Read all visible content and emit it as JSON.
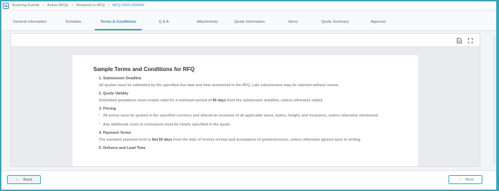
{
  "breadcrumb": {
    "items": [
      "Sourcing Events",
      "Active RFQs",
      "Respond to RFQ",
      "RFQ-2025-000040"
    ],
    "separator": ">"
  },
  "tabs": [
    {
      "label": "General Information"
    },
    {
      "label": "Schedule"
    },
    {
      "label": "Terms & Conditions",
      "active": true
    },
    {
      "label": "Q & A"
    },
    {
      "label": "Attachments"
    },
    {
      "label": "Quote Information"
    },
    {
      "label": "Items"
    },
    {
      "label": "Quote Summary"
    },
    {
      "label": "Approval"
    }
  ],
  "viewer": {
    "toolbar_icons": [
      "document-icon",
      "fullscreen-icon"
    ],
    "document": {
      "title": "Sample Terms and Conditions for RFQ",
      "sections": [
        {
          "heading": "1. Submission Deadline",
          "text": "All quotes must be submitted by the specified due date and time mentioned in the RFQ. Late submissions may be rejected without review."
        },
        {
          "heading": "2. Quote Validity",
          "text_before": "Submitted quotations must remain valid for a minimum period of ",
          "emphasis": "90 days",
          "text_after": " from the submission deadline, unless otherwise stated."
        },
        {
          "heading": "3. Pricing",
          "bullets": [
            "All prices must be quoted in the specified currency and should be inclusive of all applicable taxes, duties, freight, and insurance, unless otherwise mentioned.",
            "Any additional costs or exclusions must be clearly specified in the quote."
          ]
        },
        {
          "heading": "4. Payment Terms",
          "text_before": "The standard payment term is ",
          "emphasis": "Net 60 days",
          "text_after": " from the date of invoice receipt and acceptance of goods/services, unless otherwise agreed upon in writing."
        },
        {
          "heading": "5. Delivery and Lead Time"
        }
      ]
    }
  },
  "footer": {
    "back_label": "Back",
    "next_label": "Next"
  },
  "colors": {
    "accent": "#3aa3b5",
    "link": "#3f7fb5",
    "muted_text": "#8a9098"
  }
}
